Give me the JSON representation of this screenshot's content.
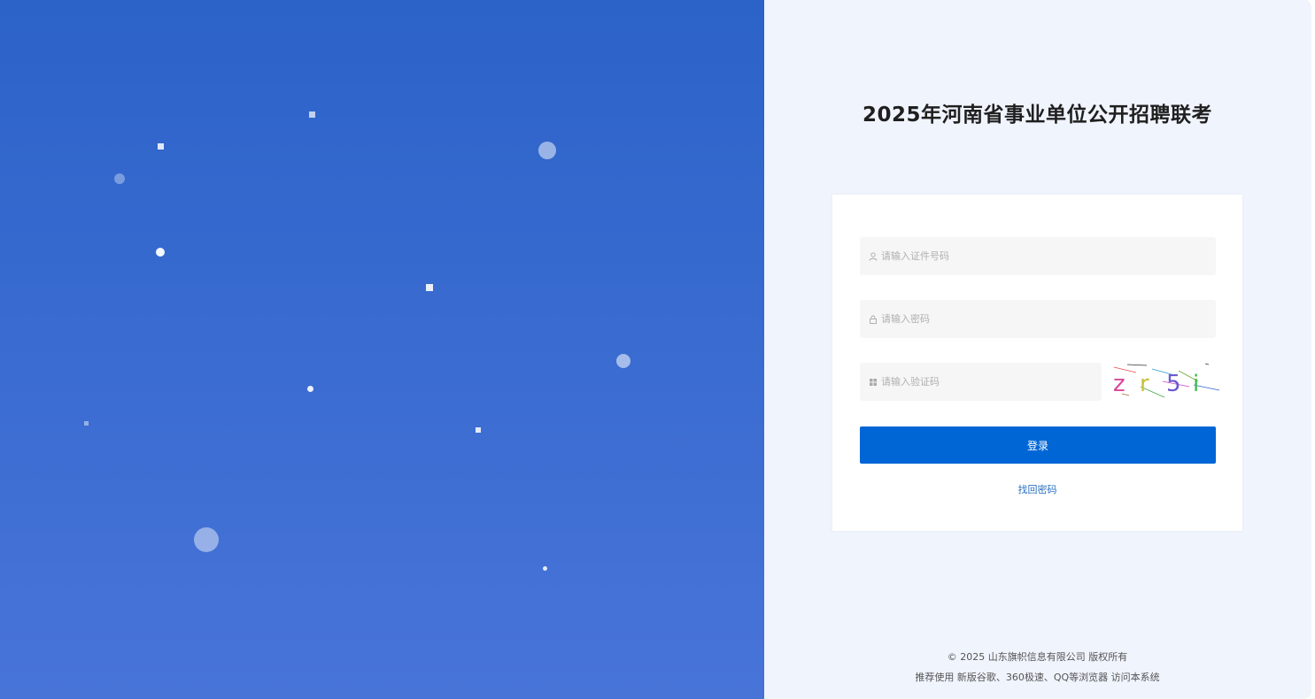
{
  "page": {
    "title": "2025年河南省事业单位公开招聘联考"
  },
  "login_form": {
    "id_placeholder": "请输入证件号码",
    "password_placeholder": "请输入密码",
    "captcha_placeholder": "请输入验证码",
    "captcha_text": "zr5i",
    "login_label": "登录",
    "forgot_password_label": "找回密码"
  },
  "footer": {
    "copyright": "© 2025 山东旗帜信息有限公司 版权所有",
    "browser_note": "推荐使用 新版谷歌、360极速、QQ等浏览器 访问本系统"
  },
  "colors": {
    "brand_blue": "#0066d6",
    "panel_gradient_top": "#2c63c9",
    "panel_gradient_bottom": "#4874d8"
  },
  "icons": {
    "id_field": "user-icon",
    "password_field": "lock-icon",
    "captcha_field": "grid-icon"
  }
}
